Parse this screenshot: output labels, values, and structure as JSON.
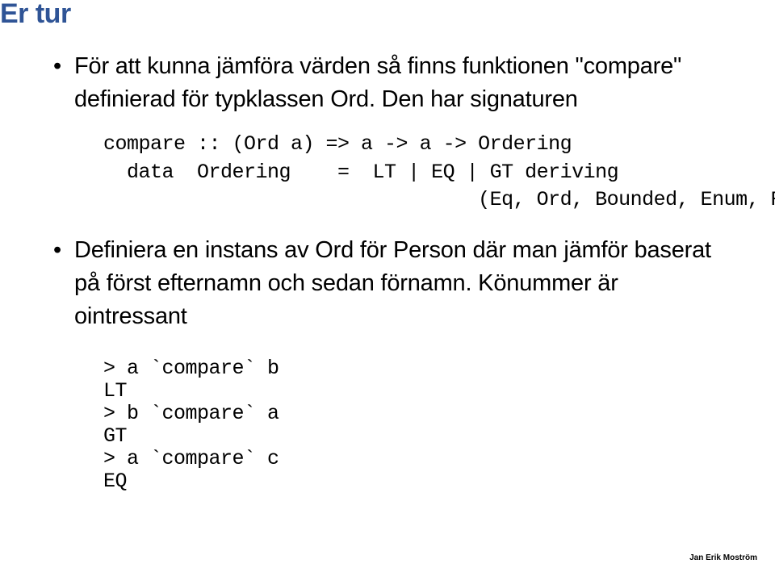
{
  "title": "Er tur",
  "bullets": {
    "b1": "För att kunna jämföra värden så finns funktionen \"compare\" definierad för typklassen Ord. Den har signaturen",
    "b2": "Definiera en instans av Ord för Person där man jämför baserat på först efternamn och sedan förnamn. Könummer är ointressant"
  },
  "code1": "compare :: (Ord a) => a -> a -> Ordering\n  data  Ordering    =  LT | EQ | GT deriving\n                                (Eq, Ord, Bounded, Enum, Read, Show)",
  "code2": "> a `compare` b\nLT\n> b `compare` a\nGT\n> a `compare` c\nEQ",
  "footer": "Jan Erik Moström"
}
